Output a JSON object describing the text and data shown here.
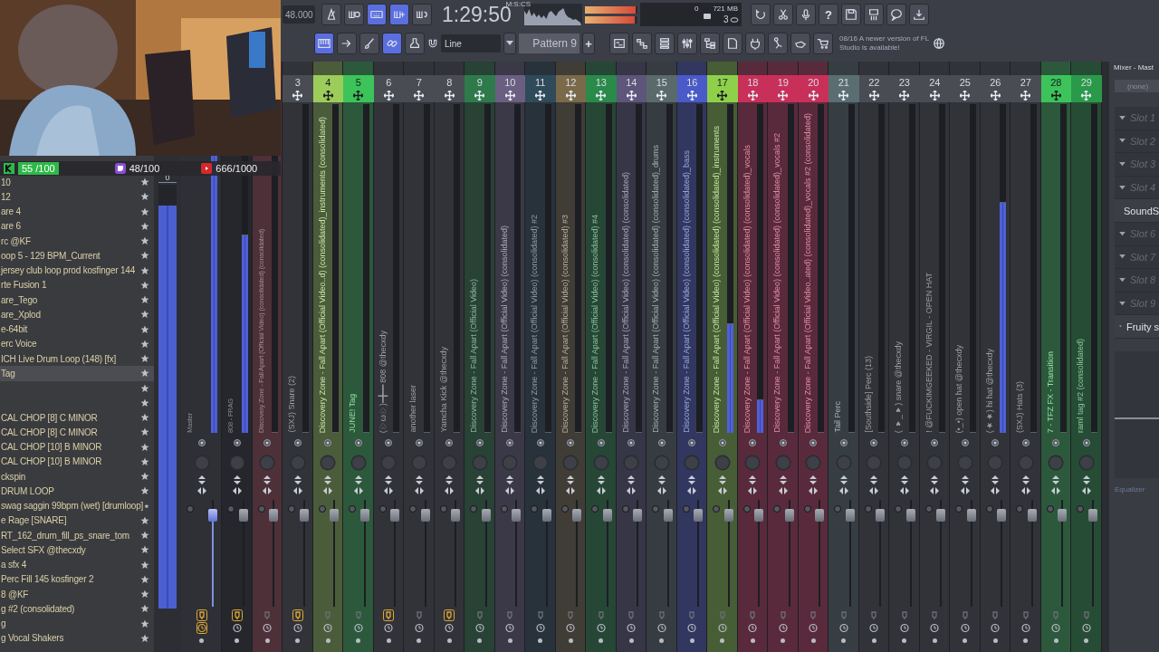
{
  "overlay_counters": [
    {
      "kind": "kick",
      "text": "55 /100",
      "color": "#2fb84a"
    },
    {
      "kind": "twitch",
      "text": "48/100",
      "color": "#8a4fd8"
    },
    {
      "kind": "youtube",
      "text": "666/1000",
      "color": "#d42a2a"
    }
  ],
  "toolbar": {
    "tempo": "48.000",
    "row1_left": [
      {
        "on": false
      },
      {
        "on": false
      },
      {
        "on": true
      },
      {
        "on": true
      },
      {
        "on": false
      }
    ],
    "time": "1:29:50",
    "time_format": "M:S:CS",
    "output_levels": [
      {
        "level": 0.97
      },
      {
        "level": 0.95
      }
    ],
    "cpu": "0",
    "memory": "721 MB",
    "polyphony": "3",
    "row1_right": [
      {
        "on": false
      },
      {
        "on": false
      },
      {
        "on": false
      },
      {
        "on": false,
        "text": "?"
      },
      {
        "on": false
      },
      {
        "on": false
      },
      {
        "on": false
      },
      {
        "on": false
      }
    ],
    "row2_left": [
      {
        "on": true
      },
      {
        "on": false
      },
      {
        "on": false
      },
      {
        "on": true
      },
      {
        "on": false
      }
    ],
    "snap": "Line",
    "pattern": "Pattern 9",
    "pattern_add": "+",
    "row2_right": [
      {
        "on": false
      },
      {
        "on": false
      },
      {
        "on": false
      },
      {
        "on": false
      },
      {
        "on": false
      },
      {
        "on": false
      },
      {
        "on": false
      },
      {
        "on": false
      },
      {
        "on": false
      },
      {
        "on": false
      }
    ],
    "news": {
      "date": "08/16",
      "message": "A newer version of FL Studio is available!"
    }
  },
  "browser": {
    "items": [
      {
        "label": "10",
        "selected": false
      },
      {
        "label": "12",
        "selected": false
      },
      {
        "label": "are 4",
        "selected": false
      },
      {
        "label": "are 6",
        "selected": false
      },
      {
        "label": "rc @KF",
        "selected": false
      },
      {
        "label": "oop 5 - 129 BPM_Current",
        "selected": false
      },
      {
        "label": "jersey club loop prod kosfinger 144",
        "selected": false
      },
      {
        "label": "rte Fusion 1",
        "selected": false
      },
      {
        "label": "are_Tego",
        "selected": false
      },
      {
        "label": "are_Xplod",
        "selected": false
      },
      {
        "label": "e-64bit",
        "selected": false
      },
      {
        "label": "erc Voice",
        "selected": false
      },
      {
        "label": "ICH Live Drum Loop (148) [fx]",
        "selected": false
      },
      {
        "label": "Tag",
        "selected": true
      },
      {
        "selected": false
      },
      {
        "selected": false
      },
      {
        "label": "CAL CHOP [8] C MINOR",
        "selected": false
      },
      {
        "label": "CAL CHOP [8] C MINOR",
        "selected": false
      },
      {
        "label": "CAL CHOP [10] B MINOR",
        "selected": false
      },
      {
        "label": "CAL CHOP [10] B MINOR",
        "selected": false
      },
      {
        "label": "ckspin",
        "selected": false
      },
      {
        "label": "DRUM LOOP",
        "selected": false
      },
      {
        "label": "swag saggin 99bpm (wet) [drumloop]",
        "selected": false
      },
      {
        "label": "e Rage [SNARE]",
        "selected": false
      },
      {
        "label": "RT_162_drum_fill_ps_snare_tom",
        "selected": false
      },
      {
        "label": "Select SFX @thecxdy",
        "selected": false
      },
      {
        "label": "a sfx 4",
        "selected": false
      },
      {
        "label": "Perc Fill 145 kosfinger 2",
        "selected": false
      },
      {
        "label": "8 @KF",
        "selected": false
      },
      {
        "label": "g #2 (consolidated)",
        "selected": false
      },
      {
        "label": "g",
        "selected": false
      },
      {
        "label": "g Vocal Shakers",
        "selected": false
      }
    ]
  },
  "master_meter": {
    "peak": "0",
    "level": 0.95
  },
  "mixer": {
    "strips": [
      {
        "name": "Master",
        "color": "#2e3036",
        "selected": true,
        "armed": true,
        "meter": {
          "level": 0.95
        },
        "fader": {
          "level": 0.9
        }
      },
      {
        "name": "808 - FRAG",
        "color": "#25272c",
        "selected": false,
        "armed": true,
        "meter": {
          "level": 0.6
        },
        "fader": {
          "level": 0.9
        }
      },
      {
        "name": "Discovery Zone - Fall Apart (Official Video) (consolidated) (consolidated)",
        "color": "#4e3038",
        "selected": false,
        "armed": false,
        "meter": {
          "level": 0
        },
        "fader": {
          "level": 0.9
        }
      },
      {
        "number": "3",
        "name": "(SXJ) Snare (2)",
        "color": "#4a4c54",
        "selected": false,
        "armed": true,
        "meter": {
          "level": 0
        },
        "fader": {
          "level": 0.9
        }
      },
      {
        "number": "4",
        "name": "Discovery Zone - Fall Apart (Official Video..d) (consolidated)_instruments (consolidated)",
        "color": "#9ccc5a",
        "selected": false,
        "armed": false,
        "meter": {
          "level": 0
        },
        "fader": {
          "level": 0.9
        }
      },
      {
        "number": "5",
        "name": "JUNE! Tag",
        "color": "#3cc45a",
        "selected": false,
        "armed": false,
        "meter": {
          "level": 0
        },
        "fader": {
          "level": 0.9
        }
      },
      {
        "number": "6",
        "name": "(♡ω♡)━╋━━ 808 @thecxdy",
        "color": "#4a4c54",
        "selected": false,
        "armed": true,
        "meter": {
          "level": 0
        },
        "fader": {
          "level": 0.9
        }
      },
      {
        "number": "7",
        "name": "another laser",
        "color": "#4a4c54",
        "selected": false,
        "armed": false,
        "meter": {
          "level": 0
        },
        "fader": {
          "level": 0.9
        }
      },
      {
        "number": "8",
        "name": "Yamcha Kick @thecxdy",
        "color": "#4a4c54",
        "selected": false,
        "armed": true,
        "meter": {
          "level": 0
        },
        "fader": {
          "level": 0.9
        }
      },
      {
        "number": "9",
        "name": "Discovery Zone - Fall Apart (Official Video)",
        "color": "#2f7a4a",
        "selected": false,
        "armed": false,
        "meter": {
          "level": 0
        },
        "fader": {
          "level": 0.9
        }
      },
      {
        "number": "10",
        "name": "Discovery Zone - Fall Apart (Official Video) (consolidated)",
        "color": "#6a5f80",
        "selected": false,
        "armed": false,
        "meter": {
          "level": 0
        },
        "fader": {
          "level": 0.9
        }
      },
      {
        "number": "11",
        "name": "Discovery Zone - Fall Apart (Official Video) (consolidated) #2",
        "color": "#2f4a5a",
        "selected": false,
        "armed": false,
        "meter": {
          "level": 0
        },
        "fader": {
          "level": 0.9
        }
      },
      {
        "number": "12",
        "name": "Discovery Zone - Fall Apart (Official Video) (consolidated) #3",
        "color": "#7a6a4a",
        "selected": false,
        "armed": false,
        "meter": {
          "level": 0
        },
        "fader": {
          "level": 0.9
        }
      },
      {
        "number": "13",
        "name": "Discovery Zone - Fall Apart (Official Video) (consolidated) #4",
        "color": "#2a8a4a",
        "selected": false,
        "armed": false,
        "meter": {
          "level": 0
        },
        "fader": {
          "level": 0.9
        }
      },
      {
        "number": "14",
        "name": "Discovery Zone - Fall Apart (Official Video) (consolidated) (consolidated)",
        "color": "#5e557a",
        "selected": false,
        "armed": false,
        "meter": {
          "level": 0
        },
        "fader": {
          "level": 0.9
        }
      },
      {
        "number": "15",
        "name": "Discovery Zone - Fall Apart (Official Video) (consolidated) (consolidated)_drums",
        "color": "#5a6a6a",
        "selected": false,
        "armed": false,
        "meter": {
          "level": 0
        },
        "fader": {
          "level": 0.9
        }
      },
      {
        "number": "16",
        "name": "Discovery Zone - Fall Apart (Official Video) (consolidated) (consolidated)_bass",
        "color": "#4a5ac8",
        "selected": false,
        "armed": false,
        "meter": {
          "level": 0
        },
        "fader": {
          "level": 0.9
        }
      },
      {
        "number": "17",
        "name": "Discovery Zone - Fall Apart (Official Video) (consolidated) (consolidated)_instruments",
        "color": "#8fd04a",
        "selected": false,
        "armed": false,
        "meter": {
          "level": 0.33
        },
        "fader": {
          "level": 0.9
        }
      },
      {
        "number": "18",
        "name": "Discovery Zone - Fall Apart (Official Video) (consolidated) (consolidated)_vocals",
        "color": "#c8305a",
        "selected": false,
        "armed": false,
        "meter": {
          "level": 0.1
        },
        "fader": {
          "level": 0.9
        }
      },
      {
        "number": "19",
        "name": "Discovery Zone - Fall Apart (Official Video) (consolidated) (consolidated)_vocals #2",
        "color": "#c8305a",
        "selected": false,
        "armed": false,
        "meter": {
          "level": 0
        },
        "fader": {
          "level": 0.9
        }
      },
      {
        "number": "20",
        "name": "Discovery Zone - Fall Apart (Official Video..ated) (consolidated)_vocals #2 (consolidated)",
        "color": "#c8305a",
        "selected": false,
        "armed": false,
        "meter": {
          "level": 0
        },
        "fader": {
          "level": 0.9
        }
      },
      {
        "number": "21",
        "name": "Tail Perc",
        "color": "#5a6e72",
        "selected": false,
        "armed": false,
        "meter": {
          "level": 0
        },
        "fader": {
          "level": 0.9
        }
      },
      {
        "number": "22",
        "name": "[Southside] Perc (13)",
        "color": "#4a4c54",
        "selected": false,
        "armed": false,
        "meter": {
          "level": 0
        },
        "fader": {
          "level": 0.9
        }
      },
      {
        "number": "23",
        "name": "( ♥_♥) snare @thecxdy",
        "color": "#4a4c54",
        "selected": false,
        "armed": false,
        "meter": {
          "level": 0
        },
        "fader": {
          "level": 0.9
        }
      },
      {
        "number": "24",
        "name": "! @FUCKIMGEEKED - VIRGIL - OPEN HAT",
        "color": "#4a4c54",
        "selected": false,
        "armed": false,
        "meter": {
          "level": 0
        },
        "fader": {
          "level": 0.9
        }
      },
      {
        "number": "25",
        "name": "(•_•) open hat @thecxdy",
        "color": "#4a4c54",
        "selected": false,
        "armed": false,
        "meter": {
          "level": 0
        },
        "fader": {
          "level": 0.9
        }
      },
      {
        "number": "26",
        "name": "(★★) hi hat @thecxdy",
        "color": "#4a4c54",
        "selected": false,
        "armed": false,
        "meter": {
          "level": 0.7
        },
        "fader": {
          "level": 0.9
        }
      },
      {
        "number": "27",
        "name": "(SXJ) Hats (3)",
        "color": "#4a4c54",
        "selected": false,
        "armed": false,
        "meter": {
          "level": 0
        },
        "fader": {
          "level": 0.9
        }
      },
      {
        "number": "28",
        "name": "7 - TFZ FX - Transition",
        "color": "#3cc45a",
        "selected": false,
        "armed": false,
        "meter": {
          "level": 0
        },
        "fader": {
          "level": 0.9
        }
      },
      {
        "number": "29",
        "name": "raml tag #2 (consolidated)",
        "color": "#2a9a4a",
        "selected": false,
        "armed": false,
        "meter": {
          "level": 0
        },
        "fader": {
          "level": 0.9
        }
      }
    ]
  },
  "inspector": {
    "title": "Mixer - Mast",
    "routing": "(none)",
    "slots": [
      {
        "label": "Slot 1",
        "filled": false
      },
      {
        "label": "Slot 2",
        "filled": false
      },
      {
        "label": "Slot 3",
        "filled": false
      },
      {
        "label": "Slot 4",
        "filled": false
      },
      {
        "label": "SoundS",
        "filled": true
      },
      {
        "label": "Slot 6",
        "filled": false
      },
      {
        "label": "Slot 7",
        "filled": false
      },
      {
        "label": "Slot 8",
        "filled": false
      },
      {
        "label": "Slot 9",
        "filled": false
      },
      {
        "label": "Fruity s",
        "filled": true
      }
    ],
    "eq_label": "Equalizer"
  }
}
